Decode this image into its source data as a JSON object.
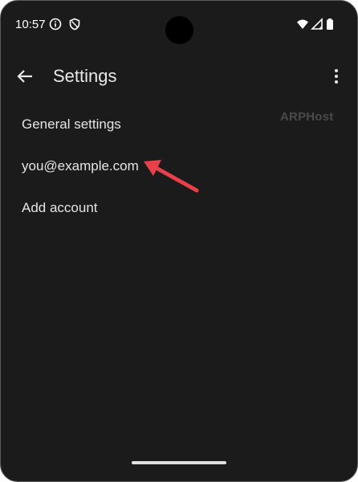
{
  "status_bar": {
    "time": "10:57",
    "left_icons": [
      "info-icon",
      "shield-icon"
    ],
    "right_icons": [
      "wifi-icon",
      "cellular-icon",
      "battery-icon"
    ]
  },
  "app_bar": {
    "title": "Settings",
    "back_icon": "arrow-back-icon",
    "menu_icon": "more-vert-icon"
  },
  "watermark": {
    "text": "ARPHost"
  },
  "settings": {
    "items": [
      {
        "label": "General settings"
      },
      {
        "label": "you@example.com"
      },
      {
        "label": "Add account"
      }
    ]
  },
  "annotation": {
    "arrow_color": "#e8404a"
  },
  "colors": {
    "background": "#1b1b1c",
    "text": "#e4e4e4",
    "accent_arrow": "#e8404a"
  }
}
